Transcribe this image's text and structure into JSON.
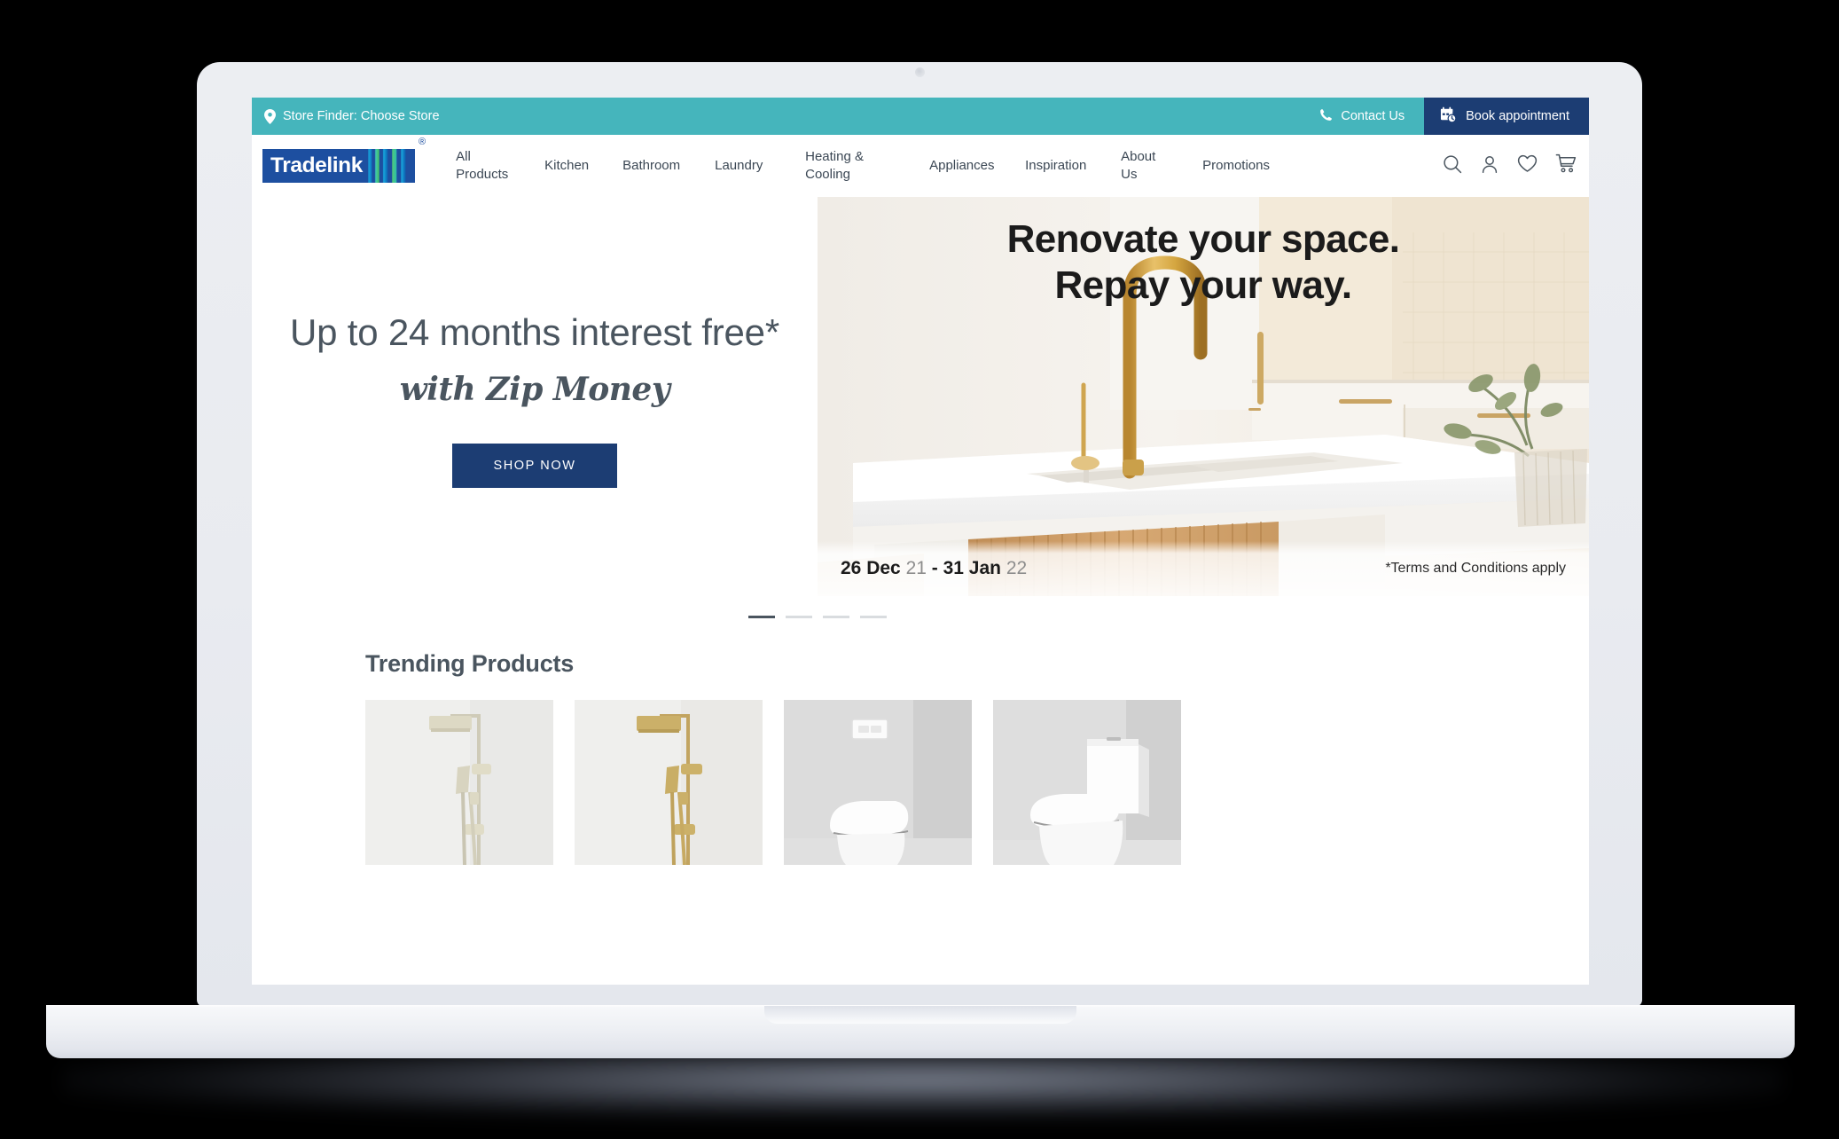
{
  "device": {
    "type": "laptop-mockup",
    "camera": "camera-dot"
  },
  "site": {
    "brand": {
      "wordmark": "Tradelink",
      "registered_mark": "®"
    },
    "utility_bar": {
      "background": "#45b5bc",
      "store_finder": "Store Finder: Choose Store",
      "contact_us": "Contact Us",
      "book_appointment": "Book appointment",
      "book_appointment_bg": "#1c3d73"
    },
    "nav": {
      "items": [
        "All\nProducts",
        "Kitchen",
        "Bathroom",
        "Laundry",
        "Heating &\nCooling",
        "Appliances",
        "Inspiration",
        "About\nUs",
        "Promotions"
      ],
      "icons": [
        "search-icon",
        "account-icon",
        "wishlist-heart-icon",
        "cart-icon"
      ]
    },
    "hero": {
      "headline": "Up to 24 months interest free*",
      "subheadline": "with Zip Money",
      "cta_label": "SHOP NOW",
      "cta_bg": "#1c3d73",
      "banner": {
        "title_line1": "Renovate your space.",
        "title_line2": "Repay your way.",
        "date_start": "26 Dec",
        "date_start_year": "21",
        "date_separator": "-",
        "date_end": "31 Jan",
        "date_end_year": "22",
        "terms": "*Terms and Conditions apply",
        "scene": "kitchen with gold tap and white double sink"
      },
      "carousel": {
        "count": 4,
        "active_index": 0
      }
    },
    "trending": {
      "title": "Trending Products",
      "products": [
        {
          "name": "shower-rail-chrome"
        },
        {
          "name": "shower-rail-brass"
        },
        {
          "name": "wall-faced-toilet-pan"
        },
        {
          "name": "close-coupled-toilet-suite"
        }
      ]
    }
  }
}
